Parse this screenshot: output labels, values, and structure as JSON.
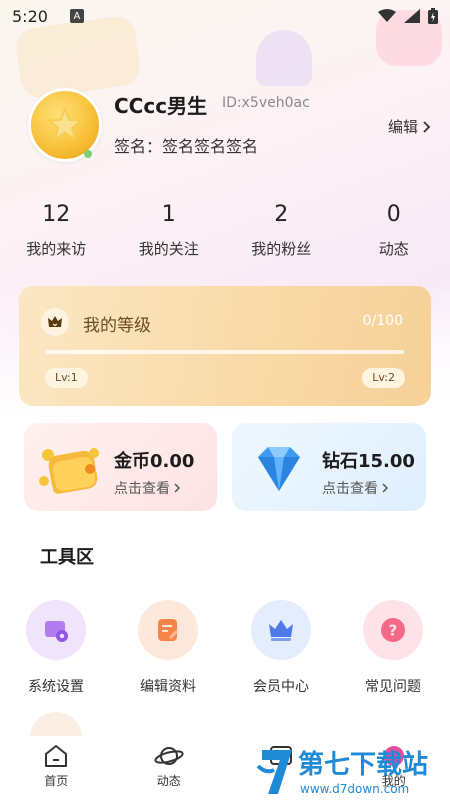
{
  "status_bar": {
    "time": "5:20",
    "a_badge": "A"
  },
  "profile": {
    "username": "CCcc男生",
    "id": "ID:x5veh0ac",
    "signature_label": "签名：",
    "signature_value": "签名签名签名",
    "edit_label": "编辑"
  },
  "stats": [
    {
      "value": "12",
      "label": "我的来访"
    },
    {
      "value": "1",
      "label": "我的关注"
    },
    {
      "value": "2",
      "label": "我的粉丝"
    },
    {
      "value": "0",
      "label": "动态"
    }
  ],
  "level": {
    "title": "我的等级",
    "progress_text": "0/100",
    "progress_fraction": 0,
    "current_level": "Lv:1",
    "next_level": "Lv:2"
  },
  "wallet": {
    "coins": {
      "title": "金币0.00",
      "action": "点击查看"
    },
    "diamonds": {
      "title": "钻石15.00",
      "action": "点击查看"
    }
  },
  "tools": {
    "title": "工具区",
    "items": [
      {
        "label": "系统设置",
        "icon": "settings-icon"
      },
      {
        "label": "编辑资料",
        "icon": "edit-profile-icon"
      },
      {
        "label": "会员中心",
        "icon": "crown-icon"
      },
      {
        "label": "常见问题",
        "icon": "question-icon"
      }
    ]
  },
  "nav": {
    "items": [
      {
        "label": "首页",
        "icon": "home-icon"
      },
      {
        "label": "动态",
        "icon": "planet-icon"
      },
      {
        "label": "",
        "icon": "message-icon"
      },
      {
        "label": "我的",
        "icon": "profile-icon"
      }
    ]
  },
  "watermark": {
    "title": "第七下载站",
    "url": "www.d7down.com"
  },
  "colors": {
    "accent_gold": "#f8c23a",
    "level_text": "#6a4a22",
    "watermark_blue": "#1f8ad6"
  }
}
